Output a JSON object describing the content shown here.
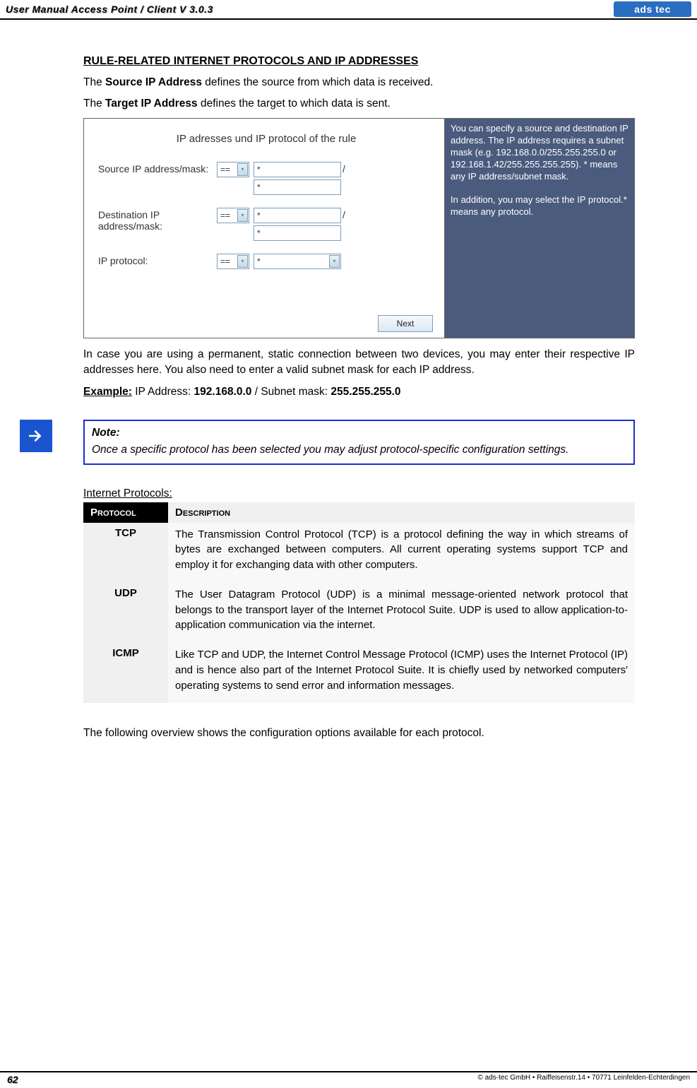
{
  "header": {
    "title": "User Manual Access Point / Client V 3.0.3",
    "logo": "ads tec"
  },
  "section": {
    "heading": "RULE-RELATED INTERNET PROTOCOLS AND IP ADDRESSES",
    "p1_pre": "The ",
    "p1_bold": "Source IP Address",
    "p1_post": " defines the source from which data is received.",
    "p2_pre": "The ",
    "p2_bold": "Target IP Address",
    "p2_post": " defines the target to which data is sent."
  },
  "screenshot": {
    "title": "IP adresses und IP protocol of the rule",
    "row1_label": "Source IP address/mask:",
    "row2_label": "Destination IP address/mask:",
    "row3_label": "IP protocol:",
    "op": "==",
    "val": "*",
    "next": "Next",
    "side1": "You can specify a source and destination IP address. The IP address requires a subnet mask (e.g. 192.168.0.0/255.255.255.0 or 192.168.1.42/255.255.255.255). * means any IP address/subnet mask.",
    "side2": "In addition, you may select the IP protocol.* means any protocol."
  },
  "post_ss": "In case you are using a permanent, static connection between two devices, you may enter their respective IP addresses here. You also need to enter a valid subnet mask for each IP address.",
  "example": {
    "label": "Example:",
    "pre": " IP Address: ",
    "ip": "192.168.0.0",
    "mid": " / Subnet mask: ",
    "mask": "255.255.255.0"
  },
  "note": {
    "title": "Note:",
    "body": "Once a specific protocol has been selected you may adjust protocol-specific configuration settings."
  },
  "table": {
    "caption": "Internet Protocols:",
    "h1": "Protocol",
    "h2": "Description",
    "rows": [
      {
        "proto": "TCP",
        "desc": "The Transmission Control Protocol (TCP) is a protocol defining the way in which streams of bytes are exchanged between computers. All current operating systems support TCP and employ it for exchanging data with other computers."
      },
      {
        "proto": "UDP",
        "desc": "The User Datagram Protocol (UDP) is a minimal message-oriented network protocol that belongs to the transport layer of the Internet Protocol Suite. UDP is used to allow application-to-application communication via the internet."
      },
      {
        "proto": "ICMP",
        "desc": "Like TCP and UDP, the Internet Control Message Protocol (ICMP) uses the Internet Protocol (IP) and is hence also part of the Internet Protocol Suite. It is chiefly used by networked computers' operating systems to send error and information messages."
      }
    ]
  },
  "closing": "The following overview shows the configuration options available for each protocol.",
  "footer": {
    "page": "62",
    "copy": "© ads-tec GmbH • Raiffeisenstr.14 • 70771 Leinfelden-Echterdingen"
  }
}
